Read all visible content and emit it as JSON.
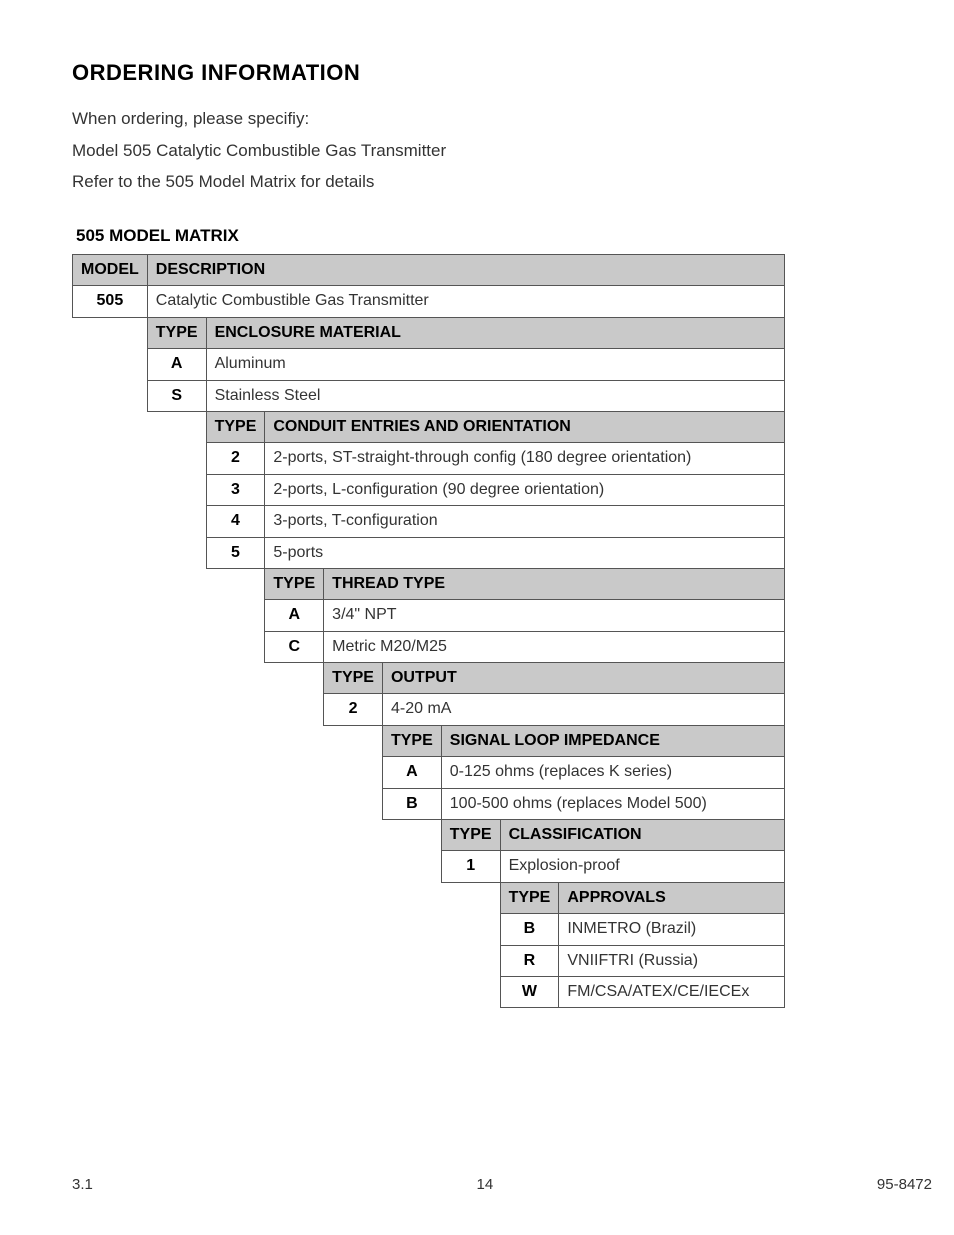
{
  "heading": "ORDERING INFORMATION",
  "intro": {
    "line1": "When ordering, please specifiy:",
    "line2": "Model 505 Catalytic Combustible Gas Transmitter",
    "line3": "Refer to the 505 Model Matrix for details"
  },
  "matrix_title": "505 MODEL MATRIX",
  "hdr": {
    "model": "MODEL",
    "description": "DESCRIPTION",
    "type": "TYPE",
    "enclosure": "ENCLOSURE MATERIAL",
    "conduit": "CONDUIT ENTRIES AND ORIENTATION",
    "thread": "THREAD TYPE",
    "output": "OUTPUT",
    "impedance": "SIGNAL LOOP IMPEDANCE",
    "classification": "CLASSIFICATION",
    "approvals": "APPROVALS"
  },
  "model": {
    "code": "505",
    "desc": "Catalytic Combustible Gas Transmitter"
  },
  "enclosure": [
    {
      "code": "A",
      "desc": "Aluminum"
    },
    {
      "code": "S",
      "desc": "Stainless Steel"
    }
  ],
  "conduit": [
    {
      "code": "2",
      "desc": "2-ports, ST-straight-through config (180 degree orientation)"
    },
    {
      "code": "3",
      "desc": "2-ports, L-configuration (90 degree orientation)"
    },
    {
      "code": "4",
      "desc": "3-ports, T-configuration"
    },
    {
      "code": "5",
      "desc": "5-ports"
    }
  ],
  "thread": [
    {
      "code": "A",
      "desc": "3/4\" NPT"
    },
    {
      "code": "C",
      "desc": "Metric M20/M25"
    }
  ],
  "output": [
    {
      "code": "2",
      "desc": "4-20 mA"
    }
  ],
  "impedance": [
    {
      "code": "A",
      "desc": "0-125 ohms (replaces K series)"
    },
    {
      "code": "B",
      "desc": "100-500 ohms (replaces Model 500)"
    }
  ],
  "classification": [
    {
      "code": "1",
      "desc": "Explosion-proof"
    }
  ],
  "approvals": [
    {
      "code": "B",
      "desc": "INMETRO (Brazil)"
    },
    {
      "code": "R",
      "desc": "VNIIFTRI (Russia)"
    },
    {
      "code": "W",
      "desc": "FM/CSA/ATEX/CE/IECEx"
    }
  ],
  "footer": {
    "left": "3.1",
    "center": "14",
    "right": "95-8472"
  },
  "chart_data": {
    "type": "table",
    "title": "505 MODEL MATRIX",
    "sections": [
      {
        "name": "MODEL",
        "rows": [
          {
            "code": "505",
            "desc": "Catalytic Combustible Gas Transmitter"
          }
        ]
      },
      {
        "name": "ENCLOSURE MATERIAL",
        "rows": [
          {
            "code": "A",
            "desc": "Aluminum"
          },
          {
            "code": "S",
            "desc": "Stainless Steel"
          }
        ]
      },
      {
        "name": "CONDUIT ENTRIES AND ORIENTATION",
        "rows": [
          {
            "code": "2",
            "desc": "2-ports, ST-straight-through config (180 degree orientation)"
          },
          {
            "code": "3",
            "desc": "2-ports, L-configuration (90 degree orientation)"
          },
          {
            "code": "4",
            "desc": "3-ports, T-configuration"
          },
          {
            "code": "5",
            "desc": "5-ports"
          }
        ]
      },
      {
        "name": "THREAD TYPE",
        "rows": [
          {
            "code": "A",
            "desc": "3/4\" NPT"
          },
          {
            "code": "C",
            "desc": "Metric M20/M25"
          }
        ]
      },
      {
        "name": "OUTPUT",
        "rows": [
          {
            "code": "2",
            "desc": "4-20 mA"
          }
        ]
      },
      {
        "name": "SIGNAL LOOP IMPEDANCE",
        "rows": [
          {
            "code": "A",
            "desc": "0-125 ohms (replaces K series)"
          },
          {
            "code": "B",
            "desc": "100-500 ohms (replaces Model 500)"
          }
        ]
      },
      {
        "name": "CLASSIFICATION",
        "rows": [
          {
            "code": "1",
            "desc": "Explosion-proof"
          }
        ]
      },
      {
        "name": "APPROVALS",
        "rows": [
          {
            "code": "B",
            "desc": "INMETRO (Brazil)"
          },
          {
            "code": "R",
            "desc": "VNIIFTRI (Russia)"
          },
          {
            "code": "W",
            "desc": "FM/CSA/ATEX/CE/IECEx"
          }
        ]
      }
    ]
  }
}
